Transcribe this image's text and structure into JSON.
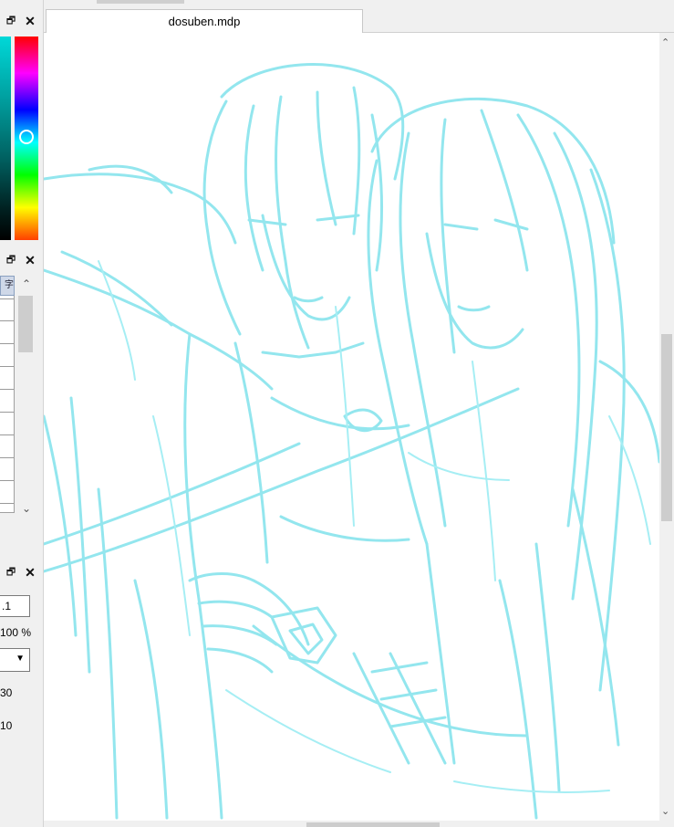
{
  "document": {
    "tab_title": "dosuben.mdp"
  },
  "panels": {
    "restore_glyph": "🗗",
    "close_glyph": "✕"
  },
  "layer_list": {
    "header_glyph": "字"
  },
  "properties": {
    "field_value": ".1",
    "opacity": "100 %",
    "value_a": "30",
    "value_b": "10"
  },
  "colors": {
    "sketch_stroke": "#93e6ee",
    "canvas_bg": "#ffffff",
    "panel_bg": "#f0f0f0"
  },
  "icons": [
    "restore-icon",
    "close-icon",
    "chevron-up-icon",
    "chevron-down-icon",
    "dropdown-arrow-icon"
  ]
}
